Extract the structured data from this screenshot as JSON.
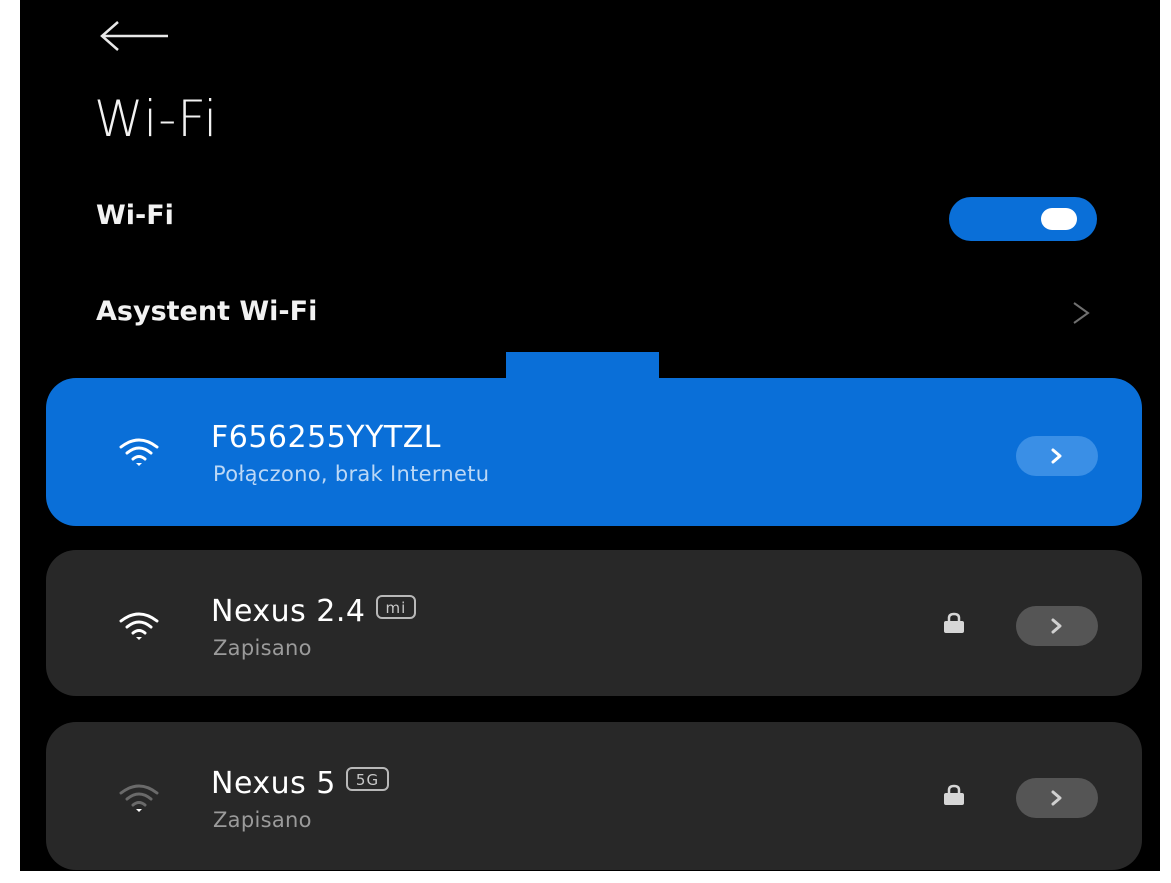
{
  "header": {
    "back_icon": "arrow-left-icon",
    "title": "Wi-Fi"
  },
  "settings": {
    "wifi_label": "Wi-Fi",
    "wifi_enabled": true,
    "assistant_label": "Asystent Wi-Fi",
    "assistant_icon": "chevron-right-icon"
  },
  "networks": [
    {
      "name": "F656255YYTZL",
      "status": "Połączono, brak Internetu",
      "badge": "",
      "connected": true,
      "locked": false,
      "signal_icon": "wifi-strong-icon"
    },
    {
      "name": "Nexus 2.4",
      "status": "Zapisano",
      "badge": "mi",
      "connected": false,
      "locked": true,
      "signal_icon": "wifi-strong-icon"
    },
    {
      "name": "Nexus 5",
      "status": "Zapisano",
      "badge": "5G",
      "connected": false,
      "locked": true,
      "signal_icon": "wifi-weak-icon"
    }
  ],
  "colors": {
    "accent": "#0a6fd8",
    "background": "#000000",
    "card": "#282828"
  }
}
